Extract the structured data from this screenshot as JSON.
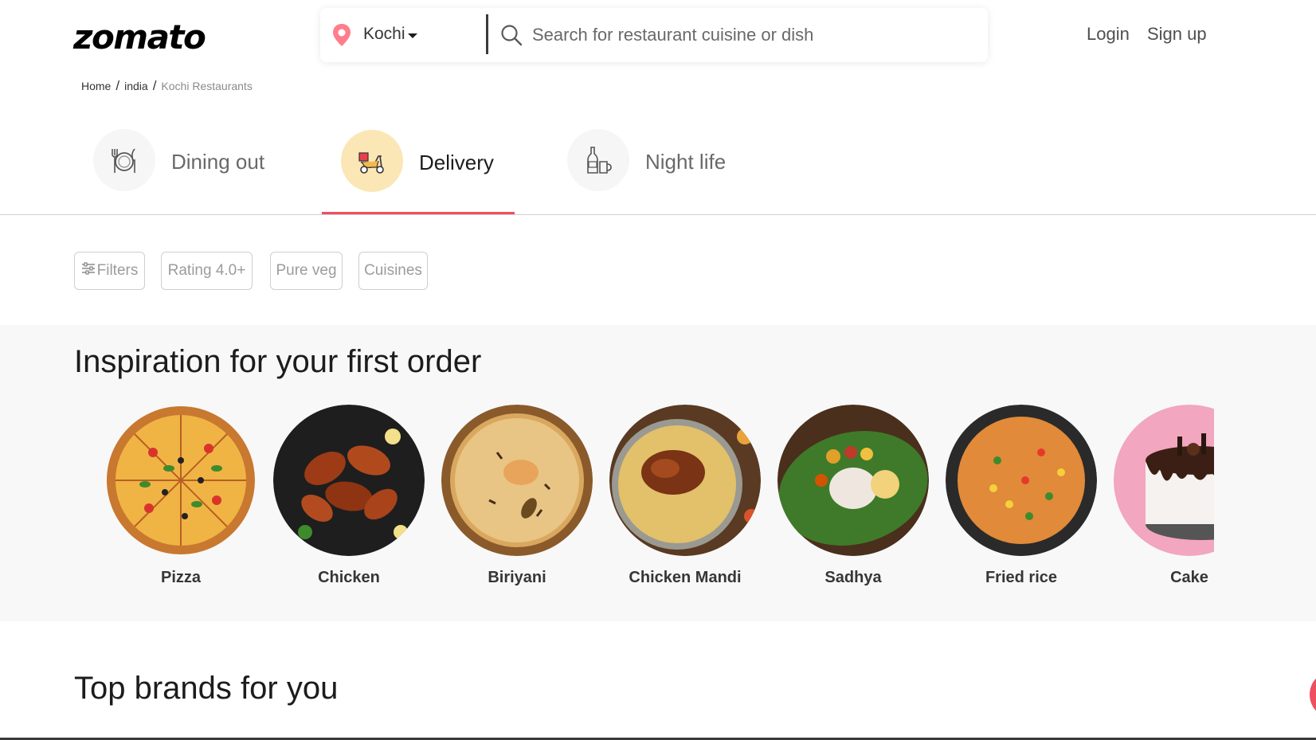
{
  "header": {
    "logo": "zomato",
    "location": "Kochi",
    "search_placeholder": "Search for restaurant cuisine or dish",
    "login": "Login",
    "signup": "Sign up"
  },
  "breadcrumb": {
    "home": "Home",
    "country": "india",
    "current": "Kochi Restaurants"
  },
  "tabs": [
    {
      "label": "Dining out",
      "icon": "dining-icon",
      "active": false
    },
    {
      "label": "Delivery",
      "icon": "scooter-icon",
      "active": true
    },
    {
      "label": "Night life",
      "icon": "bottle-icon",
      "active": false
    }
  ],
  "filters": [
    "Filters",
    "Rating 4.0+",
    "Pure veg",
    "Cuisines"
  ],
  "inspiration": {
    "title": "Inspiration for your first order",
    "items": [
      "Pizza",
      "Chicken",
      "Biriyani",
      "Chicken Mandi",
      "Sadhya",
      "Fried rice",
      "Cake"
    ]
  },
  "brands": {
    "title": "Top brands for you"
  },
  "colors": {
    "accent": "#ef4f5f",
    "delivery_bg": "#fbe7b6",
    "section_bg": "#f8f8f8"
  }
}
